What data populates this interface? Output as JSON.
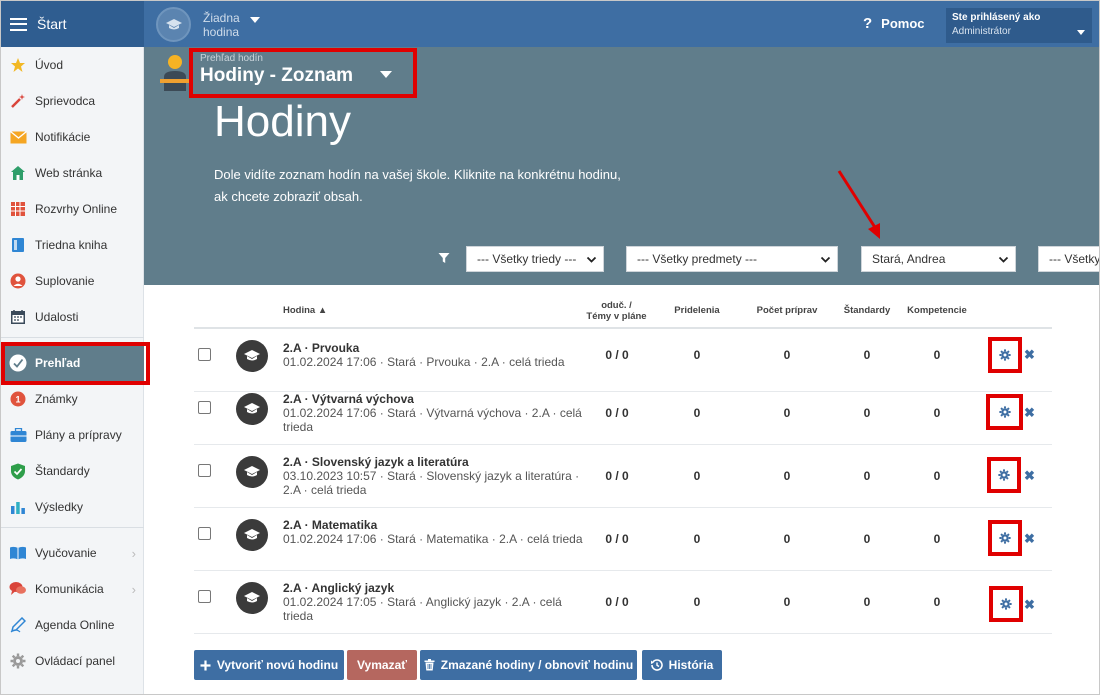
{
  "app": {
    "start_label": "Štart"
  },
  "topbar": {
    "lesson_line1": "Žiadna",
    "lesson_line2": "hodina",
    "help_label": "Pomoc",
    "user_line1": "Ste prihlásený ako",
    "user_line2": "Administrátor"
  },
  "sidebar": {
    "items": [
      {
        "label": "Úvod",
        "icon": "star-icon"
      },
      {
        "label": "Sprievodca",
        "icon": "magic-wand-icon"
      },
      {
        "label": "Notifikácie",
        "icon": "envelope-icon"
      },
      {
        "label": "Web stránka",
        "icon": "home-icon"
      },
      {
        "label": "Rozvrhy Online",
        "icon": "calendar-grid-icon"
      },
      {
        "label": "Triedna kniha",
        "icon": "book-icon"
      },
      {
        "label": "Suplovanie",
        "icon": "person-icon"
      },
      {
        "label": "Udalosti",
        "icon": "calendar-icon"
      },
      {
        "label": "Prehľad",
        "icon": "check-circle-icon"
      },
      {
        "label": "Známky",
        "icon": "grade-icon"
      },
      {
        "label": "Plány a prípravy",
        "icon": "briefcase-icon"
      },
      {
        "label": "Štandardy",
        "icon": "shield-check-icon"
      },
      {
        "label": "Výsledky",
        "icon": "bar-chart-icon"
      },
      {
        "label": "Vyučovanie",
        "icon": "open-book-icon"
      },
      {
        "label": "Komunikácia",
        "icon": "chat-icon"
      },
      {
        "label": "Agenda Online",
        "icon": "pen-icon"
      },
      {
        "label": "Ovládací panel",
        "icon": "gear-icon"
      }
    ]
  },
  "hero": {
    "crumb_small": "Prehľad hodín",
    "crumb_big": "Hodiny - Zoznam",
    "title": "Hodiny",
    "description": "Dole vidíte zoznam hodín na vašej škole. Kliknite na konkrétnu hodinu, ak chcete zobraziť obsah."
  },
  "filters": {
    "classes": "--- Všetky triedy ---",
    "subjects": "--- Všetky predmety ---",
    "teacher": "Stará, Andrea",
    "more": "--- Všetky"
  },
  "table": {
    "headers": {
      "hodina": "Hodina ▲",
      "oduc_line1": "oduč. /",
      "oduc_line2": "Témy v pláne",
      "pridelenia": "Pridelenia",
      "pocet": "Počet príprav",
      "standardy": "Štandardy",
      "kompetencie": "Kompetencie"
    },
    "rows": [
      {
        "title": "2.A · Prvouka",
        "desc": "01.02.2024 17:06 · Stará · Prvouka · 2.A · celá trieda",
        "oduc": "0 / 0",
        "pridelenia": "0",
        "pocet": "0",
        "standardy": "0",
        "kompetencie": "0"
      },
      {
        "title": "2.A · Výtvarná výchova",
        "desc": "01.02.2024 17:06 · Stará · Výtvarná výchova · 2.A · celá trieda",
        "oduc": "0 / 0",
        "pridelenia": "0",
        "pocet": "0",
        "standardy": "0",
        "kompetencie": "0"
      },
      {
        "title": "2.A · Slovenský jazyk a literatúra",
        "desc": "03.10.2023 10:57 · Stará · Slovenský jazyk a literatúra · 2.A · celá trieda",
        "oduc": "0 / 0",
        "pridelenia": "0",
        "pocet": "0",
        "standardy": "0",
        "kompetencie": "0"
      },
      {
        "title": "2.A · Matematika",
        "desc": "01.02.2024 17:06 · Stará · Matematika · 2.A · celá trieda",
        "oduc": "0 / 0",
        "pridelenia": "0",
        "pocet": "0",
        "standardy": "0",
        "kompetencie": "0"
      },
      {
        "title": "2.A · Anglický jazyk",
        "desc": "01.02.2024 17:05 · Stará · Anglický jazyk · 2.A · celá trieda",
        "oduc": "0 / 0",
        "pridelenia": "0",
        "pocet": "0",
        "standardy": "0",
        "kompetencie": "0"
      }
    ]
  },
  "buttons": {
    "create": "Vytvoriť novú hodinu",
    "delete": "Vymazať",
    "deleted": "Zmazané hodiny / obnoviť hodinu",
    "history": "História"
  },
  "colors": {
    "topbar": "#3e6ea3",
    "hero": "#607d8b",
    "annotation": "#e00000",
    "primary_button": "#3e6ea3",
    "danger_button": "#b5675f"
  }
}
